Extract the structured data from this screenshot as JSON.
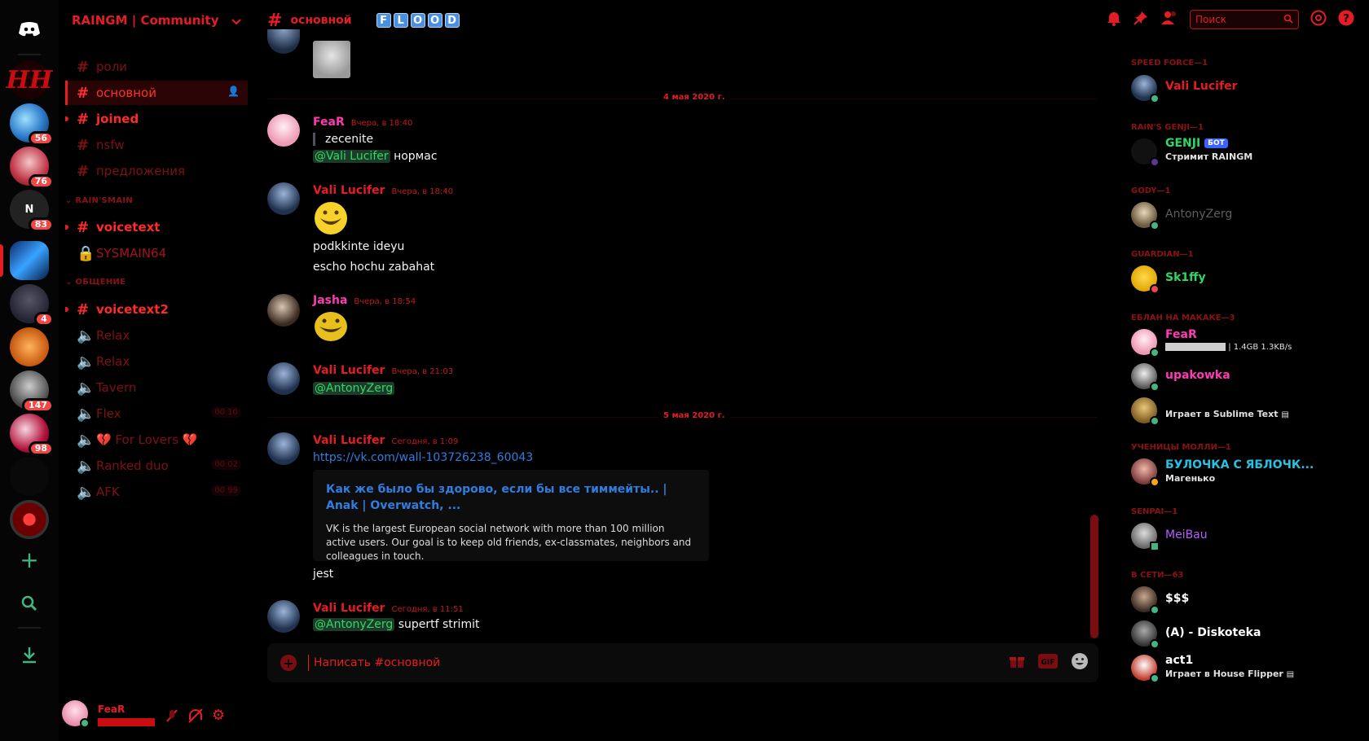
{
  "colors": {
    "accent": "#e51c23",
    "mention": "#2bd964",
    "link": "#2f7de0",
    "online": "#43b581"
  },
  "servers": {
    "badges": [
      "56",
      "76",
      "83",
      "4",
      "147",
      "98"
    ]
  },
  "guild": {
    "name": "RAINGM | Community"
  },
  "channels": {
    "top": [
      {
        "name": "роли"
      },
      {
        "name": "основной"
      },
      {
        "name": "joined"
      },
      {
        "name": "nsfw"
      },
      {
        "name": "предложения"
      }
    ],
    "cat1": "RAIN'SMAIN",
    "cat1_items": [
      {
        "name": "voicetext"
      },
      {
        "name": "SYSMAIN64"
      }
    ],
    "cat2": "ОБЩЕНИЕ",
    "cat2_items": [
      {
        "name": "voicetext2"
      },
      {
        "name": "Relax"
      },
      {
        "name": "Relax"
      },
      {
        "name": "Tavern"
      },
      {
        "name": "Flex",
        "count": "00 10"
      },
      {
        "name": "💔 For Lovers 💔"
      },
      {
        "name": "Ranked duo",
        "count": "00 02"
      },
      {
        "name": "AFK",
        "count": "00 99"
      }
    ]
  },
  "user": {
    "name": "FeaR"
  },
  "header": {
    "channel": "основной",
    "flood": [
      "F",
      "L",
      "O",
      "O",
      "D"
    ],
    "search_placeholder": "Поиск"
  },
  "dates": {
    "d1": "4 мая 2020 г.",
    "d2": "5 мая 2020 г."
  },
  "messages": [
    {
      "author": "FeaR",
      "time": "Вчера, в 18:40",
      "quote": "zecenite",
      "mention": "@Vali Lucifer",
      "text": "нормас"
    },
    {
      "author": "Vali Lucifer",
      "time": "Вчера, в 18:40",
      "line1": "podkkinte ideyu",
      "line2": "escho hochu zabahat"
    },
    {
      "author": "Jasha",
      "time": "Вчера, в 18:54"
    },
    {
      "author": "Vali Lucifer",
      "time": "Вчера, в 21:03",
      "mention": "@AntonyZerg"
    },
    {
      "author": "Vali Lucifer",
      "time": "Сегодня, в 1:09",
      "link": "https://vk.com/wall-103726238_60043",
      "embed_title": "Как же было бы здорово, если бы все тиммейты.. | Anak | Overwatch, ...",
      "embed_desc": "VK is the largest European social network with more than 100 million active users. Our goal is to keep old friends, ex-classmates, neighbors and colleagues in touch.",
      "after": "jest"
    },
    {
      "author": "Vali Lucifer",
      "time": "Сегодня, в 11:51",
      "mention": "@AntonyZerg",
      "text": "supertf strimit"
    }
  ],
  "composer": {
    "placeholder": "Написать #основной"
  },
  "members": {
    "groups": [
      {
        "title": "SPEED FORCE—1"
      },
      {
        "title": "RAIN'S GENJI—1"
      },
      {
        "title": "GODY—1"
      },
      {
        "title": "GUARDIAN—1"
      },
      {
        "title": "ЕБЛАН НА МАКАКЕ—3"
      },
      {
        "title": "УЧЕНИЦЫ МОЛЛИ—1"
      },
      {
        "title": "SENPAI—1"
      },
      {
        "title": "В СЕТИ—63"
      }
    ],
    "list": [
      {
        "name": "Vali Lucifer"
      },
      {
        "name": "GENJI",
        "tag": "БОТ",
        "sub": "Стримит RAINGM"
      },
      {
        "name": "AntonyZerg"
      },
      {
        "name": "Sk1ffy"
      },
      {
        "name": "FeaR",
        "sub": "| 1.4GB 1.3KB/s"
      },
      {
        "name": "upakowka"
      },
      {
        "name": "",
        "sub": "Играет в Sublime Text"
      },
      {
        "name": "БУЛОЧКА С ЯБЛОЧК...",
        "sub": "Магенько"
      },
      {
        "name": "MeiBau"
      },
      {
        "name": "$$$"
      },
      {
        "name": "(A) - Diskoteka"
      },
      {
        "name": "act1",
        "sub": "Играет в House Flipper"
      }
    ]
  }
}
